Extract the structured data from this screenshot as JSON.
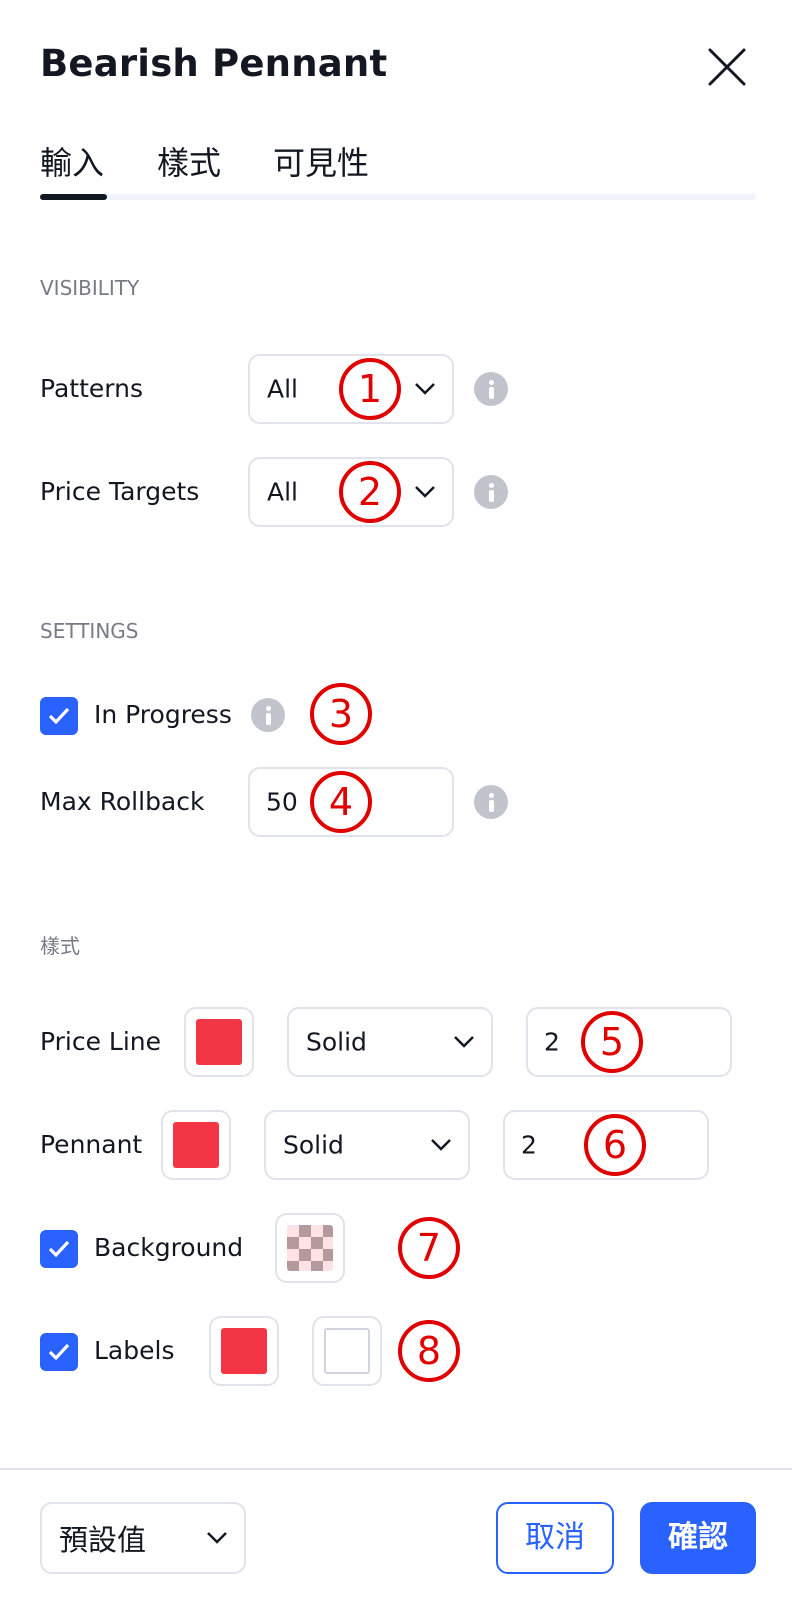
{
  "dialog": {
    "title": "Bearish Pennant",
    "close_icon": "close-icon"
  },
  "tabs": [
    {
      "label": "輸入",
      "active": true
    },
    {
      "label": "樣式",
      "active": false
    },
    {
      "label": "可見性",
      "active": false
    }
  ],
  "visibility": {
    "section_label": "VISIBILITY",
    "patterns": {
      "label": "Patterns",
      "value": "All"
    },
    "price_targets": {
      "label": "Price Targets",
      "value": "All"
    }
  },
  "settings": {
    "section_label": "SETTINGS",
    "in_progress": {
      "label": "In Progress",
      "checked": true
    },
    "max_rollback": {
      "label": "Max Rollback",
      "value": "50"
    }
  },
  "style": {
    "section_label": "樣式",
    "price_line": {
      "label": "Price Line",
      "color": "#f23645",
      "line_style": "Solid",
      "width": "2"
    },
    "pennant": {
      "label": "Pennant",
      "color": "#f23645",
      "line_style": "Solid",
      "width": "2"
    },
    "background": {
      "label": "Background",
      "checked": true,
      "color": "#f23645"
    },
    "labels": {
      "label": "Labels",
      "checked": true,
      "color": "#f23645",
      "text_color": "#ffffff"
    }
  },
  "markers": [
    "1",
    "2",
    "3",
    "4",
    "5",
    "6",
    "7",
    "8"
  ],
  "footer": {
    "defaults_label": "預設值",
    "cancel_label": "取消",
    "ok_label": "確認"
  },
  "colors": {
    "accent": "#2962ff",
    "marker": "#e00000",
    "swatch_red": "#f23645"
  }
}
